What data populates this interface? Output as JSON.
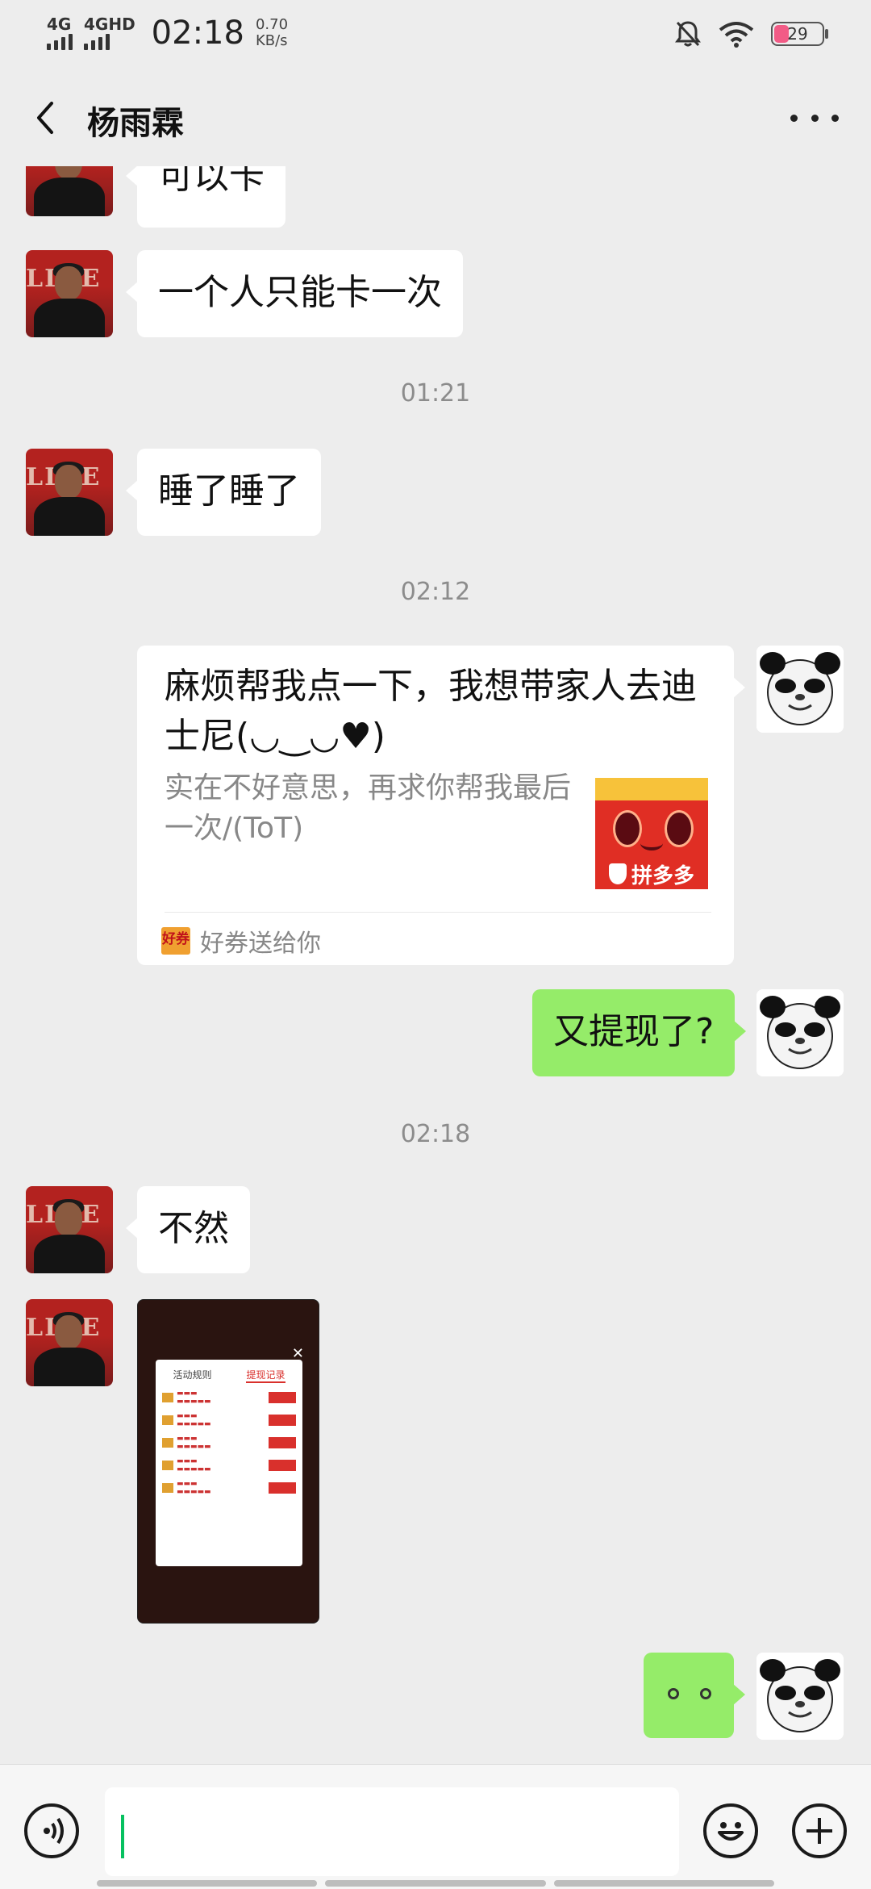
{
  "status_bar": {
    "network_1": "4G",
    "network_2": "4GHD",
    "time": "02:18",
    "speed_value": "0.70",
    "speed_unit": "KB/s",
    "battery": "29",
    "icons": [
      "mute-bell-icon",
      "wifi-icon",
      "battery-icon"
    ]
  },
  "header": {
    "title": "杨雨霖",
    "back_icon": "chevron-left-icon",
    "more_icon": "more-dots-icon"
  },
  "messages": [
    {
      "from": "contact",
      "type": "text",
      "text": "可以卡"
    },
    {
      "from": "contact",
      "type": "text",
      "text": "一个人只能卡一次"
    },
    {
      "type": "time",
      "text": "01:21"
    },
    {
      "from": "contact",
      "type": "text",
      "text": "睡了睡了"
    },
    {
      "type": "time",
      "text": "02:12"
    },
    {
      "from": "me",
      "type": "card",
      "title": "麻烦帮我点一下，我想带家人去迪士尼(◡‿◡♥)",
      "description": "实在不好意思，再求你帮我最后一次/(ToT)",
      "thumb_brand": "拼多多",
      "source": "好券送给你",
      "source_logo": "好券"
    },
    {
      "from": "me",
      "type": "text",
      "text": "又提现了?"
    },
    {
      "type": "time",
      "text": "02:18"
    },
    {
      "from": "contact",
      "type": "text",
      "text": "不然"
    },
    {
      "from": "contact",
      "type": "image",
      "image_tabs": [
        "活动规则",
        "提现记录"
      ]
    },
    {
      "from": "me",
      "type": "text",
      "text": "。。"
    }
  ],
  "input_bar": {
    "voice_icon": "voice-icon",
    "emoji_icon": "emoji-icon",
    "plus_icon": "plus-icon",
    "text": ""
  }
}
